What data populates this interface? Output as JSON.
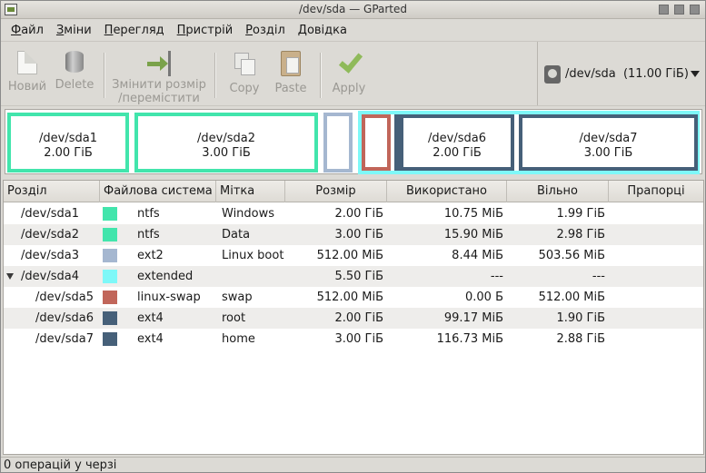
{
  "window": {
    "title": "/dev/sda — GParted"
  },
  "menu": [
    "Файл",
    "Зміни",
    "Перегляд",
    "Пристрій",
    "Розділ",
    "Довідка"
  ],
  "toolbar": {
    "new": "Новий",
    "delete": "Delete",
    "resize_line1": "Змінити розмір",
    "resize_line2": "/перемістити",
    "copy": "Copy",
    "paste": "Paste",
    "apply": "Apply"
  },
  "device": {
    "label": "/dev/sda  (11.00 ГіБ)"
  },
  "partition_map": [
    {
      "name": "/dev/sda1",
      "size": "2.00 ГіБ",
      "color": "#42e5ac"
    },
    {
      "name": "/dev/sda2",
      "size": "3.00 ГіБ",
      "color": "#42e5ac"
    },
    {
      "name": "",
      "size": "",
      "color": "#a5b7d0"
    },
    {
      "name": "",
      "size": "",
      "color": "#c1665a"
    },
    {
      "name": "/dev/sda6",
      "size": "2.00 ГіБ",
      "color": "#466079"
    },
    {
      "name": "/dev/sda7",
      "size": "3.00 ГіБ",
      "color": "#466079"
    }
  ],
  "extended_color": "#7ef8f8",
  "table": {
    "headers": [
      "Розділ",
      "Файлова система",
      "Мітка",
      "Розмір",
      "Використано",
      "Вільно",
      "Прапорці"
    ],
    "rows": [
      {
        "part": "/dev/sda1",
        "fs": "ntfs",
        "color": "#42e5ac",
        "label": "Windows",
        "size": "2.00 ГіБ",
        "used": "10.75 МіБ",
        "free": "1.99 ГіБ",
        "flags": ""
      },
      {
        "part": "/dev/sda2",
        "fs": "ntfs",
        "color": "#42e5ac",
        "label": "Data",
        "size": "3.00 ГіБ",
        "used": "15.90 МіБ",
        "free": "2.98 ГіБ",
        "flags": ""
      },
      {
        "part": "/dev/sda3",
        "fs": "ext2",
        "color": "#a5b7d0",
        "label": "Linux boot",
        "size": "512.00 МіБ",
        "used": "8.44 МіБ",
        "free": "503.56 МіБ",
        "flags": ""
      },
      {
        "part": "/dev/sda4",
        "fs": "extended",
        "color": "#7ef8f8",
        "label": "",
        "size": "5.50 ГіБ",
        "used": "---",
        "free": "---",
        "flags": ""
      },
      {
        "part": "/dev/sda5",
        "fs": "linux-swap",
        "color": "#c1665a",
        "label": "swap",
        "size": "512.00 МіБ",
        "used": "0.00 Б",
        "free": "512.00 МіБ",
        "flags": ""
      },
      {
        "part": "/dev/sda6",
        "fs": "ext4",
        "color": "#466079",
        "label": "root",
        "size": "2.00 ГіБ",
        "used": "99.17 МіБ",
        "free": "1.90 ГіБ",
        "flags": ""
      },
      {
        "part": "/dev/sda7",
        "fs": "ext4",
        "color": "#466079",
        "label": "home",
        "size": "3.00 ГіБ",
        "used": "116.73 МіБ",
        "free": "2.88 ГіБ",
        "flags": ""
      }
    ]
  },
  "status": "0 операцій у черзі"
}
